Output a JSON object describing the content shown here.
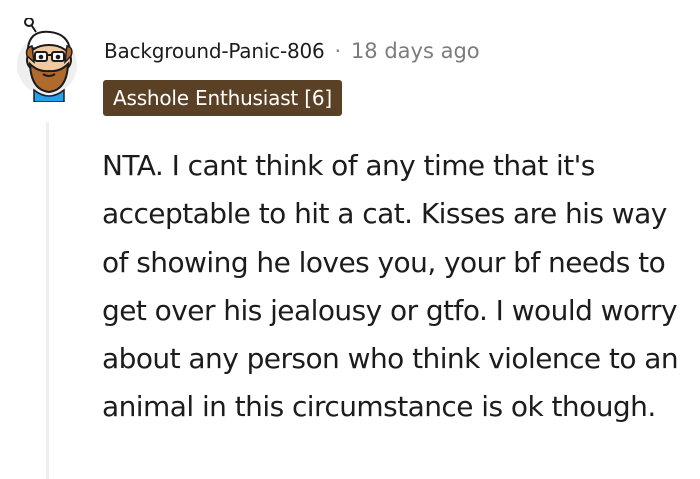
{
  "comment": {
    "author": "Background-Panic-806",
    "separator": "·",
    "timestamp": "18 days ago",
    "flair": "Asshole Enthusiast [6]",
    "body": "NTA. I cant think of any time that it's acceptable to hit a cat. Kisses are his way of showing he loves you, your bf needs to get over his jealousy or gtfo. I would worry about any person who think violence to an animal in this circumstance is ok though."
  },
  "colors": {
    "flair_background": "#5a4126",
    "flair_text": "#ffffff",
    "meta_text": "#7c7c7c",
    "body_text": "#1c1c1c",
    "thread_line": "#edeff1",
    "avatar_skin": "#f3c9a0",
    "avatar_beard": "#b06a2e",
    "avatar_hat": "#ffffff",
    "avatar_shirt": "#24a0ed"
  },
  "avatar": {
    "icon": "snoo-avatar-icon"
  }
}
